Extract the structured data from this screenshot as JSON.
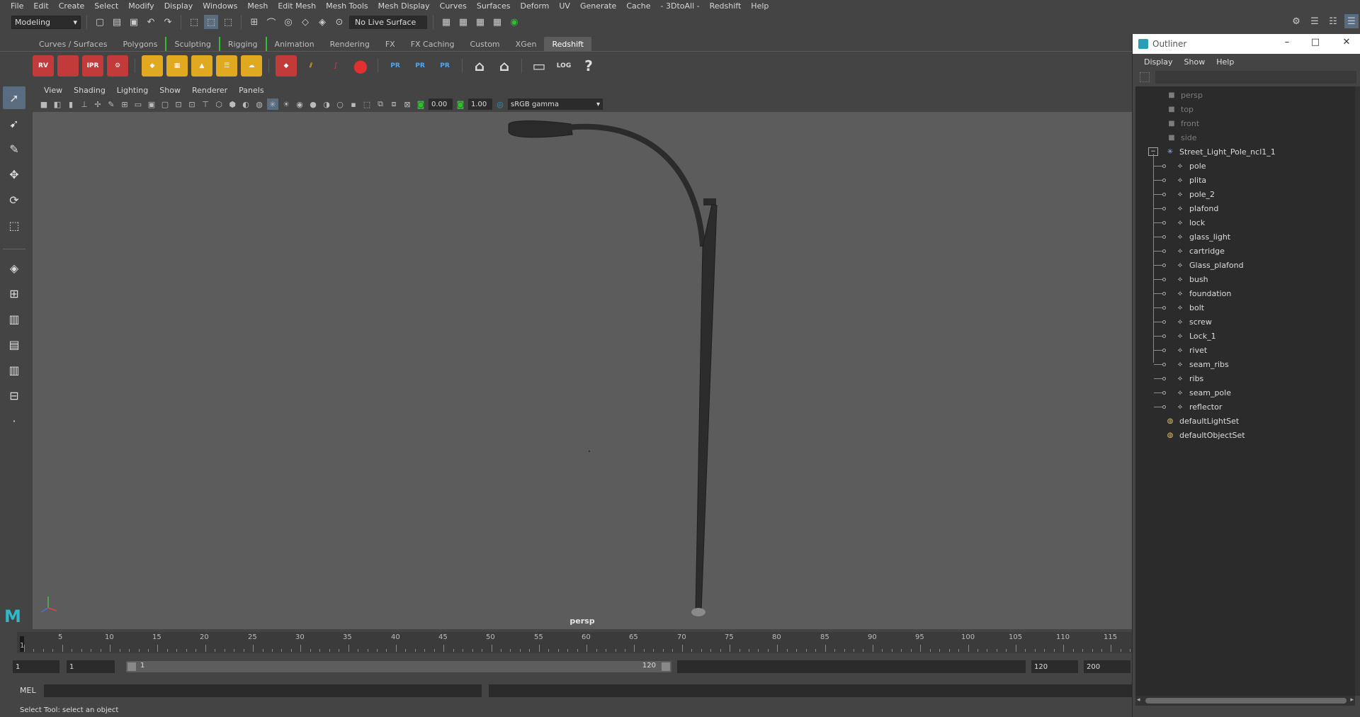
{
  "menubar": {
    "items": [
      "File",
      "Edit",
      "Create",
      "Select",
      "Modify",
      "Display",
      "Windows",
      "Mesh",
      "Edit Mesh",
      "Mesh Tools",
      "Mesh Display",
      "Curves",
      "Surfaces",
      "Deform",
      "UV",
      "Generate",
      "Cache",
      "- 3DtoAll -",
      "Redshift",
      "Help"
    ]
  },
  "statusline": {
    "mode": "Modeling",
    "live_surface": "No Live Surface"
  },
  "shelf_tabs": {
    "items": [
      "Curves / Surfaces",
      "Polygons",
      "Sculpting",
      "Rigging",
      "Animation",
      "Rendering",
      "FX",
      "FX Caching",
      "Custom",
      "XGen",
      "Redshift"
    ],
    "active": "Redshift"
  },
  "shelf": {
    "labels": [
      "RV",
      "IPR",
      "PR",
      "PR",
      "PR",
      "LOG",
      "?"
    ]
  },
  "viewport": {
    "menu": [
      "View",
      "Shading",
      "Lighting",
      "Show",
      "Renderer",
      "Panels"
    ],
    "exposure": "0.00",
    "gamma_value": "1.00",
    "color_space": "sRGB gamma",
    "camera_label": "persp"
  },
  "timeslider": {
    "ticks": [
      "1",
      "5",
      "10",
      "15",
      "20",
      "25",
      "30",
      "35",
      "40",
      "45",
      "50",
      "55",
      "60",
      "65",
      "70",
      "75",
      "80",
      "85",
      "90",
      "95",
      "100",
      "105",
      "110",
      "115"
    ]
  },
  "range": {
    "start": "1",
    "playback_start": "1",
    "range_start": "1",
    "range_end": "120",
    "playback_end": "120",
    "end": "200"
  },
  "cmdline": {
    "label": "MEL"
  },
  "helpline": {
    "text": "Select Tool: select an object"
  },
  "outliner": {
    "title": "Outliner",
    "menu": [
      "Display",
      "Show",
      "Help"
    ],
    "cameras": [
      "persp",
      "top",
      "front",
      "side"
    ],
    "group": "Street_Light_Pole_ncl1_1",
    "children": [
      "pole",
      "plita",
      "pole_2",
      "plafond",
      "lock",
      "glass_light",
      "cartridge",
      "Glass_plafond",
      "bush",
      "foundation",
      "bolt",
      "screw",
      "Lock_1",
      "rivet",
      "seam_ribs",
      "ribs",
      "seam_pole",
      "reflector"
    ],
    "sets": [
      "defaultLightSet",
      "defaultObjectSet"
    ]
  },
  "colors": {
    "viewport_bg": "#5c5c5c",
    "ui_bg": "#444444",
    "field_bg": "#2b2b2b",
    "shelf_red": "#c23a3a",
    "accent_green": "#2fbf2f",
    "highlight_blue": "#5a6d80"
  }
}
